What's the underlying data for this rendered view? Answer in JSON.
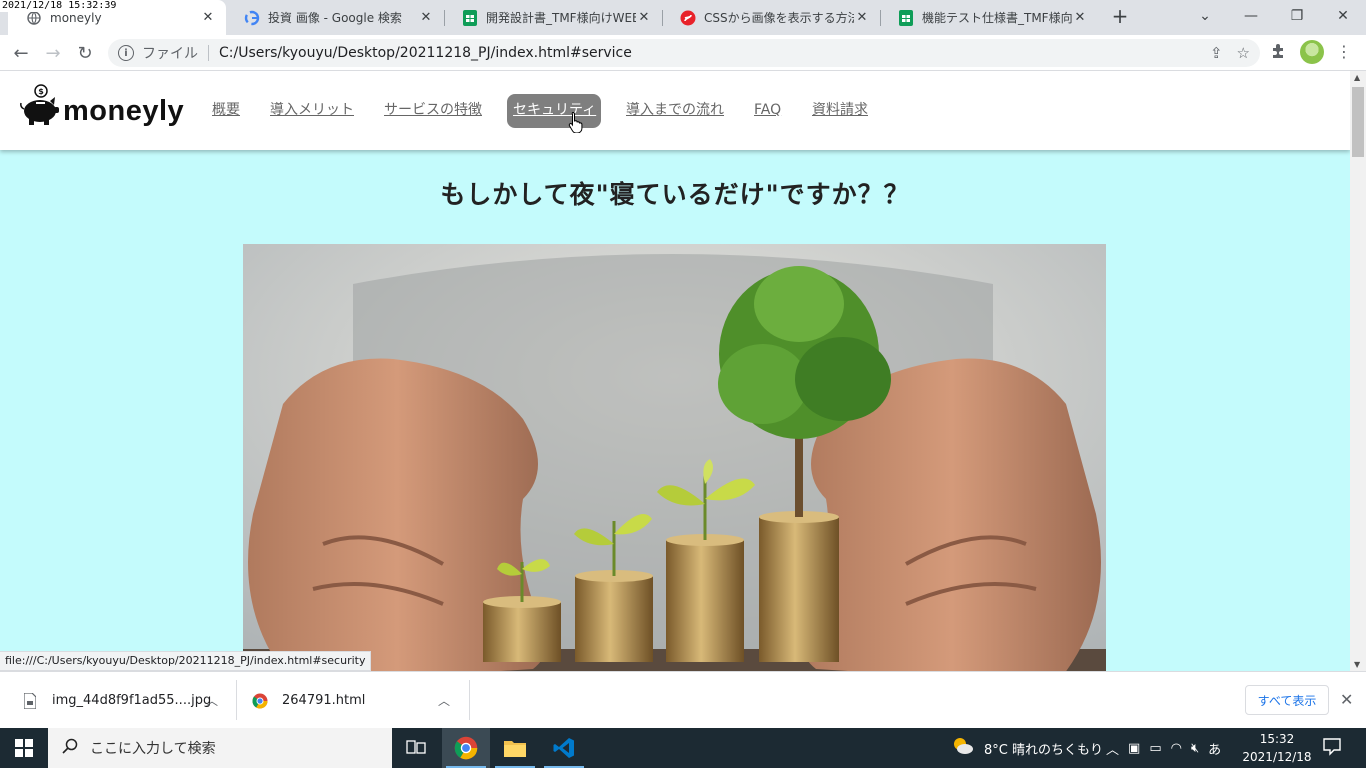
{
  "overlay_timestamp": "2021/12/18 15:32:39",
  "browser": {
    "tabs": [
      {
        "title": "moneyly",
        "icon": "globe-icon",
        "active": true
      },
      {
        "title": "投資 画像 - Google 検索",
        "icon": "google-icon",
        "active": false
      },
      {
        "title": "開発設計書_TMF様向けWEBサ",
        "icon": "sheets-icon",
        "active": false
      },
      {
        "title": "CSSから画像を表示する方法とは",
        "icon": "red-logo-icon",
        "active": false
      },
      {
        "title": "機能テスト仕様書_TMF様向けW",
        "icon": "sheets-icon",
        "active": false
      }
    ],
    "file_label": "ファイル",
    "url": "C:/Users/kyouyu/Desktop/20211218_PJ/index.html#service"
  },
  "site": {
    "logo_text": "moneyly",
    "nav": [
      {
        "label": "概要"
      },
      {
        "label": "導入メリット"
      },
      {
        "label": "サービスの特徴"
      },
      {
        "label": "セキュリティ",
        "active": true
      },
      {
        "label": "導入までの流れ"
      },
      {
        "label": "FAQ"
      },
      {
        "label": "資料請求"
      }
    ],
    "hero_title": "もしかして夜\"寝ているだけ\"ですか？？",
    "colors": {
      "page_bg": "#c4fbfc",
      "nav_active_bg": "#7f7f7f",
      "nav_text": "#666666"
    }
  },
  "status_link": "file:///C:/Users/kyouyu/Desktop/20211218_PJ/index.html#security",
  "downloads": {
    "items": [
      {
        "name": "img_44d8f9f1ad55....jpg",
        "icon": "file-icon"
      },
      {
        "name": "264791.html",
        "icon": "chrome-icon"
      }
    ],
    "show_all": "すべて表示"
  },
  "taskbar": {
    "search_placeholder": "ここに入力して検索",
    "weather": "8°C 晴れのちくもり",
    "ime": "あ",
    "time": "15:32",
    "date": "2021/12/18"
  }
}
